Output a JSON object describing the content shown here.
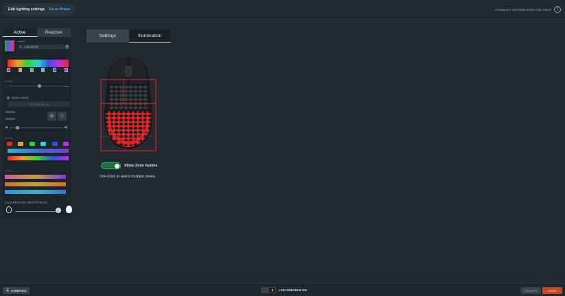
{
  "header": {
    "title": "Edit lighting settings",
    "prism_link": "Go to Prism",
    "help_label": "PRODUCT INFORMATION AND HELP",
    "help_icon": "question-icon"
  },
  "panel": {
    "tabs": [
      {
        "label": "Active",
        "active": true
      },
      {
        "label": "Reactive",
        "active": false
      }
    ],
    "effect_value": "ColorShift",
    "stop_colors": [
      "#e52727",
      "#f0a025",
      "#2fd33b",
      "#2fd3d3",
      "#2e52e6",
      "#c22ee6"
    ],
    "wave_mode_label": "Wave Mode",
    "set_origin_label": "SET ORIGIN",
    "palette_colors": [
      "#e52727",
      "#f0a025",
      "#2fd33b",
      "#2fd3d3",
      "#2e52e6",
      "#c22ee6"
    ],
    "brightness_label": "ILLUMINATION BRIGHTNESS",
    "brightness_value": 0.95
  },
  "main": {
    "tabs": [
      {
        "label": "Settings",
        "active": false
      },
      {
        "label": "Illumination",
        "active": true
      }
    ],
    "zone_guides_label": "Show Zone Guides",
    "zone_guides_on": true,
    "hint": "Ctrl+Click to select multiple zones.",
    "zone_color": "#e52727"
  },
  "footer": {
    "configs_label": "CONFIGS",
    "live_preview_label": "LIVE PREVIEW ON",
    "revert_label": "REVERT",
    "save_label": "SAVE"
  },
  "colors": {
    "accent_blue": "#4cb3ff",
    "save_orange": "#c24a2c",
    "toggle_green": "#2db85a",
    "background": "#222a31"
  }
}
